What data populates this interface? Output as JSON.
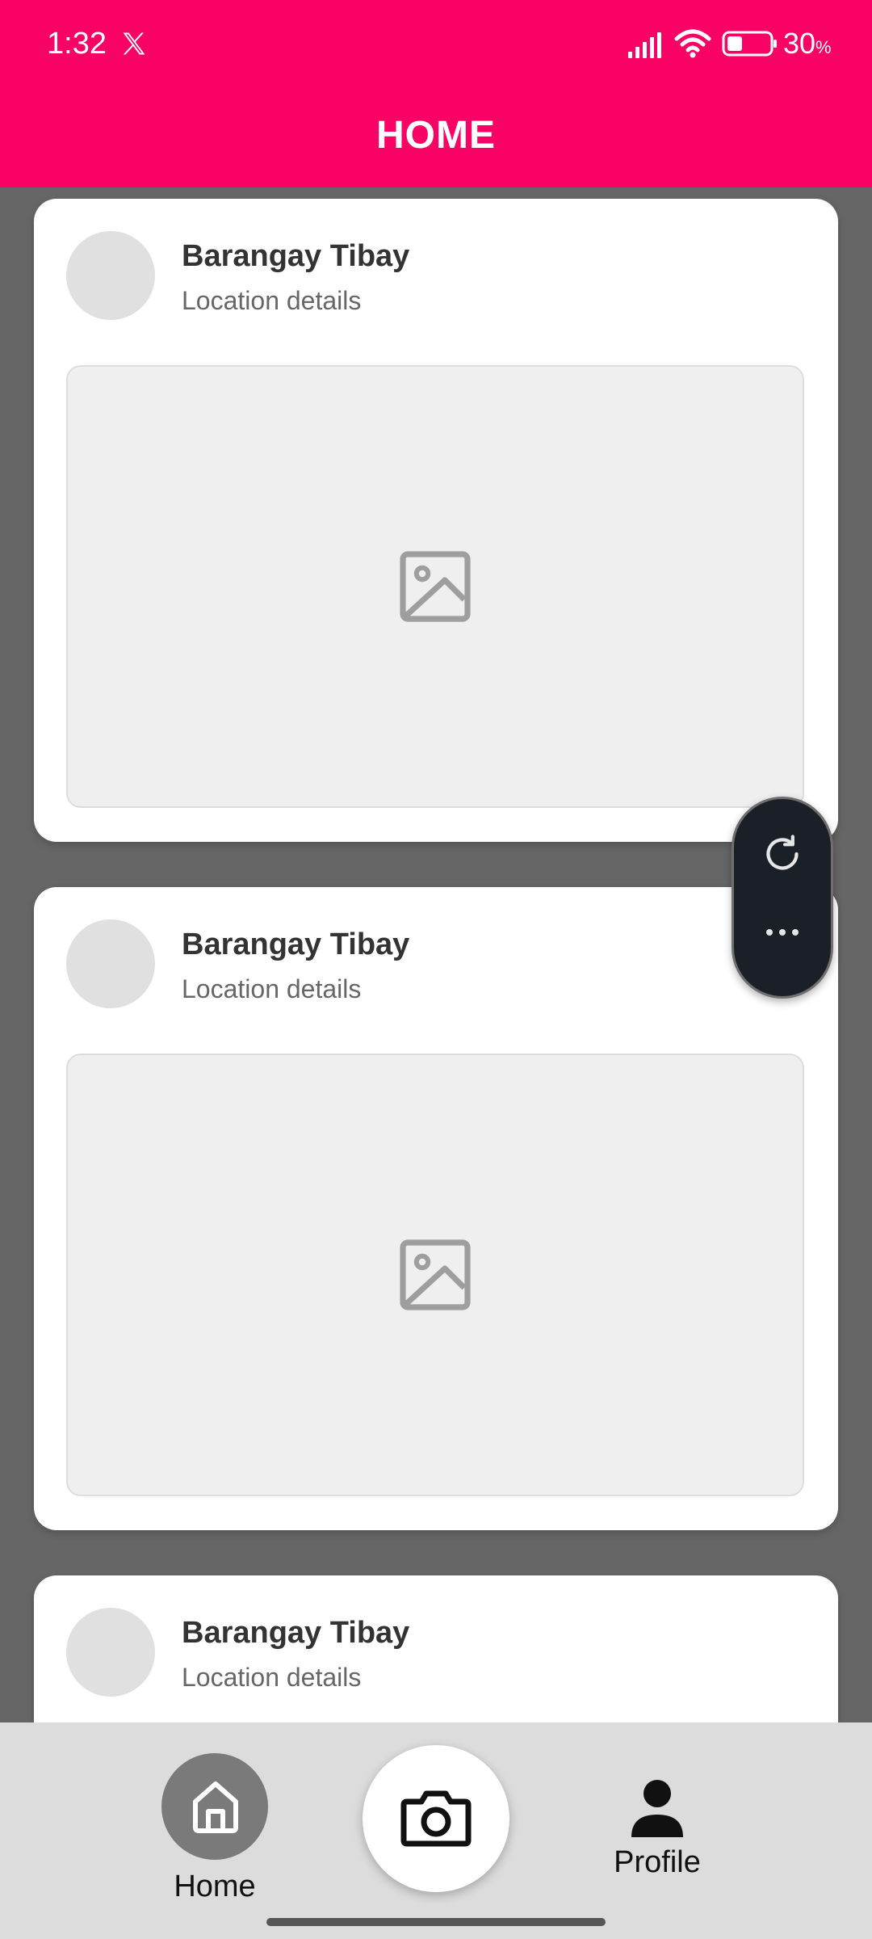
{
  "status_bar": {
    "time": "1:32",
    "battery_percent": "30",
    "battery_unit": "%"
  },
  "header": {
    "title": "HOME"
  },
  "posts": [
    {
      "title": "Barangay Tibay",
      "subtitle": "Location details"
    },
    {
      "title": "Barangay Tibay",
      "subtitle": "Location details"
    },
    {
      "title": "Barangay Tibay",
      "subtitle": "Location details"
    }
  ],
  "floating_actions": {
    "icons": [
      "refresh-icon",
      "more-horizontal-icon"
    ]
  },
  "bottom_nav": {
    "home_label": "Home",
    "profile_label": "Profile",
    "camera_icon": "camera-icon"
  },
  "colors": {
    "accent": "#F90266",
    "background": "#666666",
    "card": "#FFFFFF",
    "nav_background": "#DCDCDC",
    "fab": "#1B1F27"
  }
}
